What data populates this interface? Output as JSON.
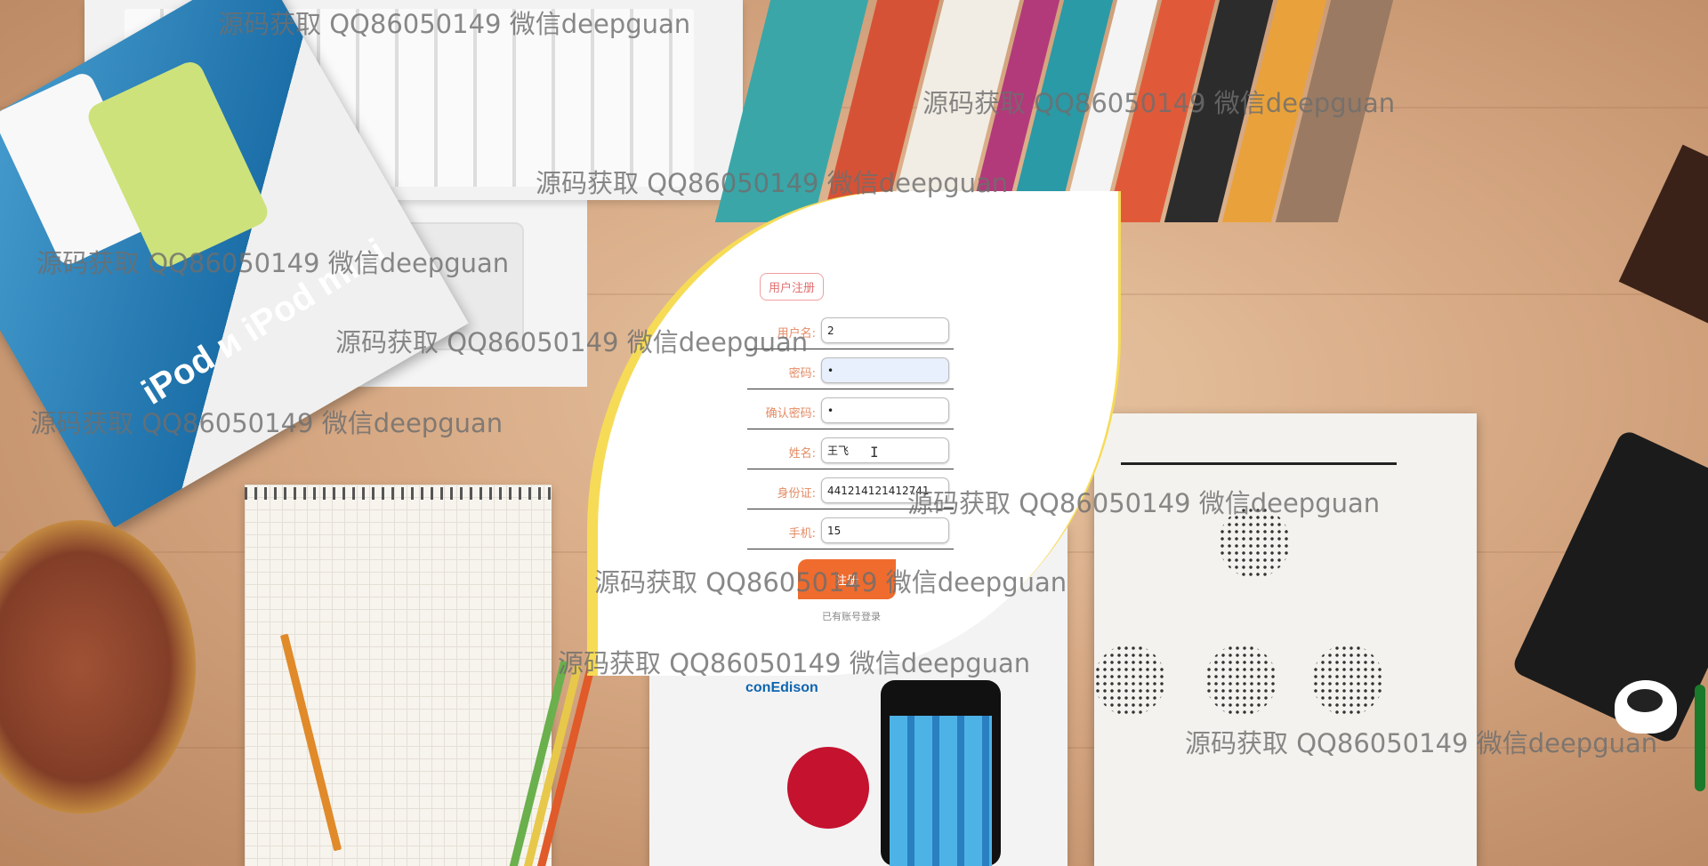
{
  "form": {
    "title": "用户注册",
    "fields": [
      {
        "label": "用户名:",
        "value": "2",
        "type": "text"
      },
      {
        "label": "密码:",
        "value": "•",
        "type": "password"
      },
      {
        "label": "确认密码:",
        "value": "•",
        "type": "password"
      },
      {
        "label": "姓名:",
        "value": "王飞",
        "type": "text"
      },
      {
        "label": "身份证:",
        "value": "441214121412741",
        "type": "text"
      },
      {
        "label": "手机:",
        "value": "15",
        "type": "text"
      }
    ],
    "submit_label": "注册",
    "login_link": "已有账号登录"
  },
  "watermark_text": "源码获取 QQ86050149 微信deepguan",
  "background": {
    "ipod_box_text": "iPod и iPod mini",
    "booklet_logo": "conEdison"
  },
  "colors": {
    "accent_orange": "#ef6c2e",
    "label_color": "#e38a63",
    "card_border_yellow": "#f6db57",
    "title_border": "#f0a0a0"
  }
}
